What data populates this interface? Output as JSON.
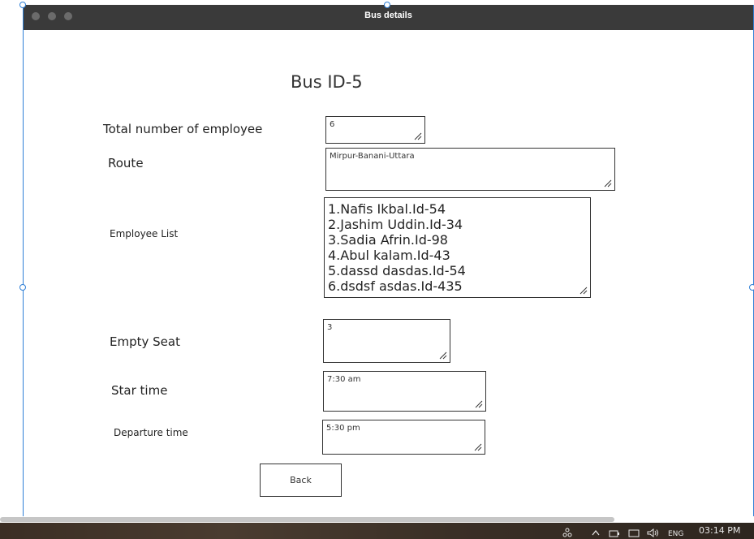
{
  "window": {
    "title": "Bus details"
  },
  "page": {
    "heading": "Bus ID-5"
  },
  "form": {
    "total_employee": {
      "label": "Total number of employee",
      "value": "6"
    },
    "route": {
      "label": "Route",
      "value": "Mirpur-Banani-Uttara"
    },
    "employee_list": {
      "label": "Employee List",
      "items": [
        "1.Nafis Ikbal.Id-54",
        "2.Jashim Uddin.Id-34",
        "3.Sadia Afrin.Id-98",
        "4.Abul kalam.Id-43",
        "5.dassd dasdas.Id-54",
        "6.dsdsf asdas.Id-435"
      ]
    },
    "empty_seat": {
      "label": "Empty Seat",
      "value": "3"
    },
    "start_time": {
      "label": "Star time",
      "value": "7:30 am"
    },
    "departure_time": {
      "label": "Departure time",
      "value": "5:30 pm"
    },
    "back_label": "Back"
  },
  "taskbar": {
    "language": "ENG",
    "time": "03:14 PM"
  },
  "icons": {
    "resize_grip": "resize-grip-icon",
    "network": "network-icon",
    "volume": "volume-icon",
    "chevron": "chevron-up-icon"
  }
}
